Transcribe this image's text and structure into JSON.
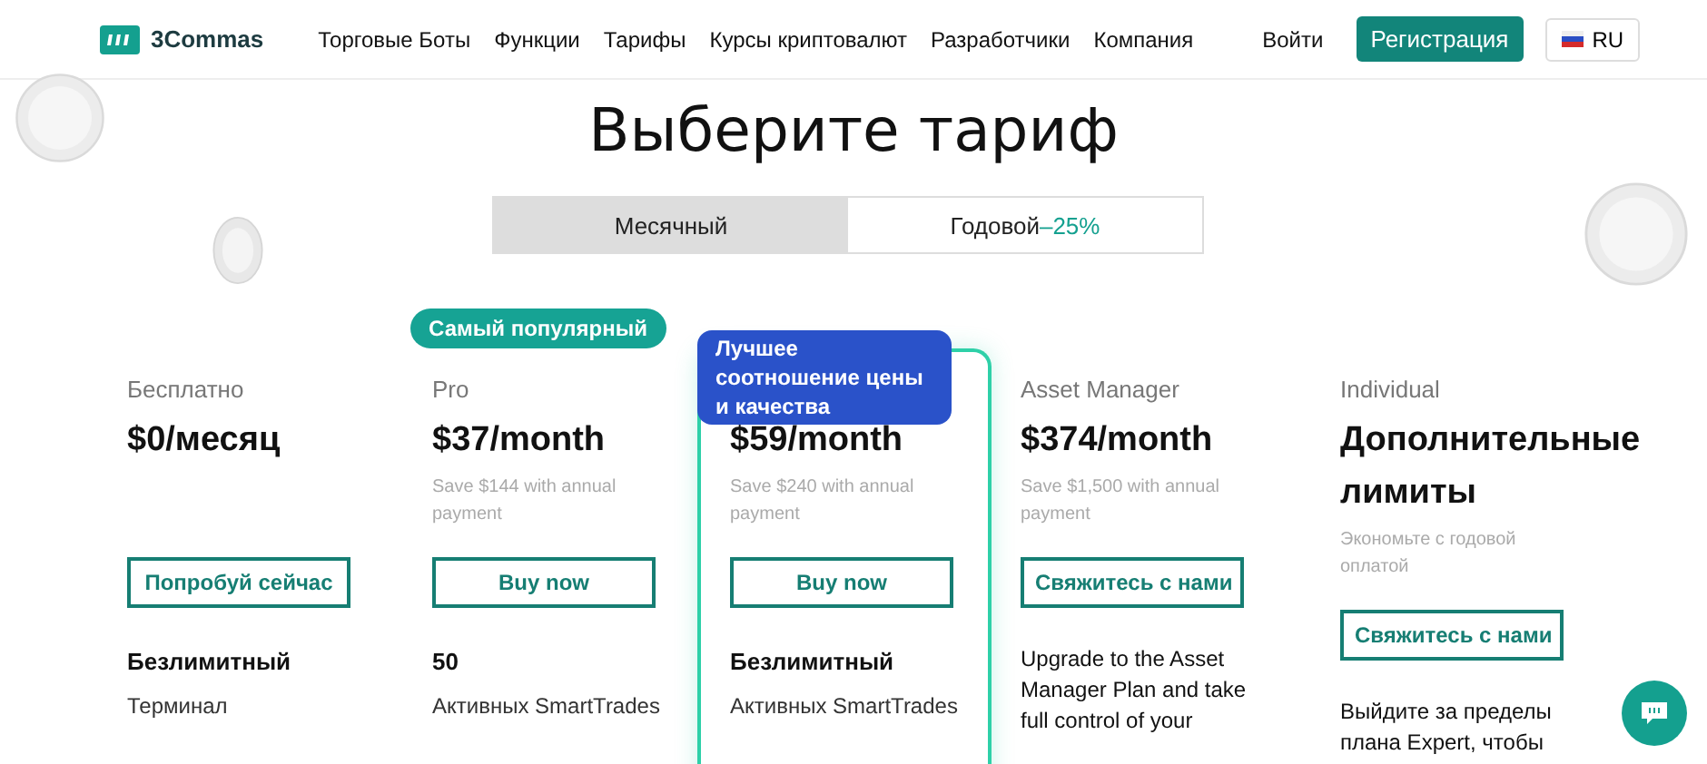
{
  "header": {
    "logo": "3Commas",
    "nav": [
      "Торговые Боты",
      "Функции",
      "Тарифы",
      "Курсы криптовалют",
      "Разработчики",
      "Компания"
    ],
    "login": "Войти",
    "signup": "Регистрация",
    "language": "RU"
  },
  "title": "Выберите тариф",
  "billing_tabs": [
    {
      "label": "Месячный",
      "selected": true
    },
    {
      "label": "Годовой",
      "discount": "–25%",
      "selected": false
    }
  ],
  "plans": [
    {
      "name": "Бесплатно",
      "price": "$0/месяц",
      "button": "Попробуй сейчас",
      "kind": "feature",
      "feature_value": "Безлимитный",
      "feature_label": "Терминал",
      "highlighted": false
    },
    {
      "badge": {
        "label": "Самый популярный",
        "color": "#16a394"
      },
      "name": "Pro",
      "price": "$37/month",
      "note": "Save $144 with annual payment",
      "button": "Buy now",
      "kind": "feature",
      "feature_value": "50",
      "feature_label": "Активных SmartTrades",
      "highlighted": false
    },
    {
      "badge": {
        "label": "Лучшее соотношение цены и качества",
        "color": "#2a52c9"
      },
      "price": "$59/month",
      "note": "Save $240 with annual payment",
      "button": "Buy now",
      "kind": "feature",
      "feature_value": "Безлимитный",
      "feature_label": "Активных SmartTrades",
      "highlighted": true
    },
    {
      "name": "Asset Manager",
      "price": "$374/month",
      "note": "Save $1,500 with annual payment",
      "button": "Свяжитесь с нами",
      "kind": "text",
      "description": "Upgrade to the Asset Manager Plan and take full control of your",
      "highlighted": false
    },
    {
      "name": "Individual",
      "price": "Дополнительные лимиты",
      "note": "Экономьте с годовой оплатой",
      "button": "Свяжитесь с нами",
      "kind": "text",
      "description": "Выйдите за пределы плана Expert, чтобы",
      "highlighted": false
    }
  ]
}
